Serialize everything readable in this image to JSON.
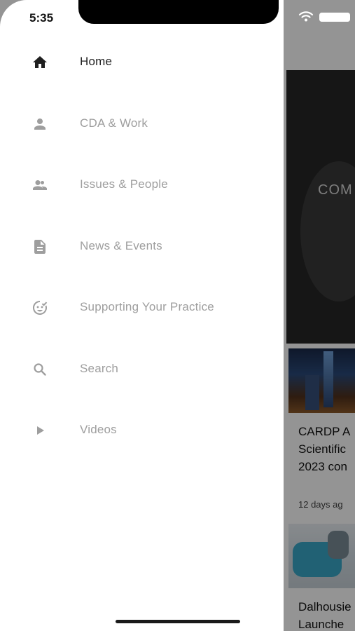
{
  "status_bar": {
    "time": "5:35"
  },
  "drawer": {
    "items": [
      {
        "label": "Home",
        "icon": "home-icon",
        "active": true
      },
      {
        "label": "CDA & Work",
        "icon": "person-icon",
        "active": false
      },
      {
        "label": "Issues & People",
        "icon": "people-icon",
        "active": false
      },
      {
        "label": "News & Events",
        "icon": "document-icon",
        "active": false
      },
      {
        "label": "Supporting Your Practice",
        "icon": "face-check-icon",
        "active": false
      },
      {
        "label": "Search",
        "icon": "search-icon",
        "active": false
      },
      {
        "label": "Videos",
        "icon": "play-icon",
        "active": false
      }
    ]
  },
  "background": {
    "hero_text": "COM",
    "card1_title_lines": [
      "CARDP A",
      "Scientific",
      "2023 con"
    ],
    "card1_date": "12 days ag",
    "card2_title_lines": [
      "Dalhousie",
      "Launche"
    ]
  },
  "colors": {
    "active": "#1f1f1f",
    "inactive": "#9e9e9e",
    "scrim": "rgba(0,0,0,0.42)"
  }
}
